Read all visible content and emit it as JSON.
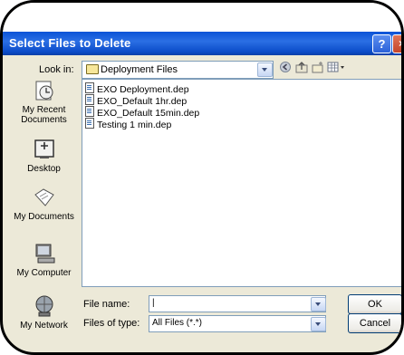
{
  "dialog": {
    "title": "Select Files to Delete",
    "help_glyph": "?",
    "close_glyph": "×"
  },
  "look_in": {
    "label": "Look in:",
    "value": "Deployment Files"
  },
  "toolbar": [
    "back-icon",
    "up-folder-icon",
    "new-folder-icon",
    "views-menu-icon"
  ],
  "places": [
    {
      "label_lines": [
        "My Recent",
        "Documents"
      ],
      "icon": "recent-documents-icon"
    },
    {
      "label_lines": [
        "Desktop"
      ],
      "icon": "desktop-icon"
    },
    {
      "label_lines": [
        "My Documents"
      ],
      "icon": "my-documents-icon"
    },
    {
      "label_lines": [
        "My Computer"
      ],
      "icon": "my-computer-icon"
    },
    {
      "label_lines": [
        "My Network"
      ],
      "icon": "my-network-icon"
    }
  ],
  "files": [
    "EXO Deployment.dep",
    "EXO_Default 1hr.dep",
    "EXO_Default 15min.dep",
    "Testing 1 min.dep"
  ],
  "file_name": {
    "label": "File name:",
    "value": "|"
  },
  "files_of_type": {
    "label": "Files of type:",
    "value": "All Files (*.*)"
  },
  "buttons": {
    "ok": "OK",
    "cancel": "Cancel"
  },
  "colors": {
    "titlebar": "#0a53d6",
    "dialog_bg": "#ece9d8",
    "frame": "#000000"
  }
}
